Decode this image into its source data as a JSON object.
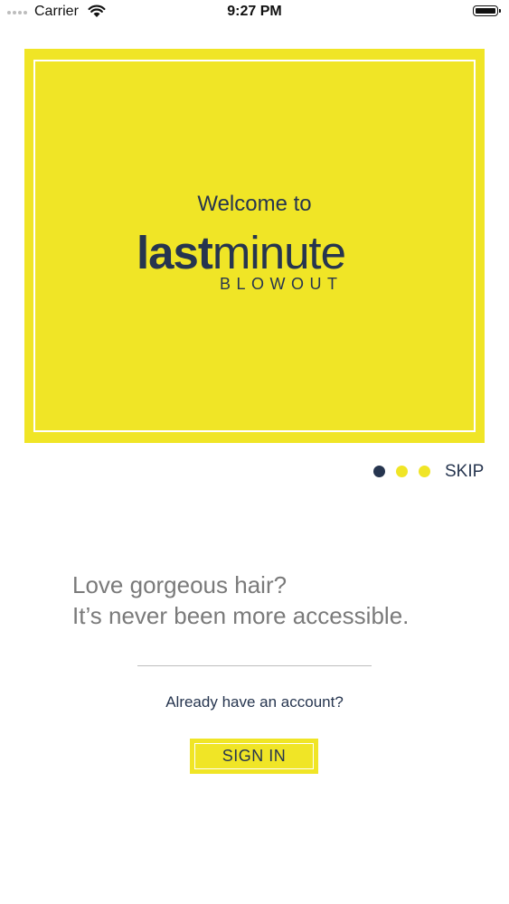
{
  "status_bar": {
    "carrier": "Carrier",
    "time": "9:27 PM",
    "icons": [
      "signal-dots-icon",
      "wifi-icon",
      "battery-icon"
    ]
  },
  "hero": {
    "welcome_text": "Welcome to",
    "logo_bold": "last",
    "logo_light": "minute",
    "logo_sub": "BLOWOUT"
  },
  "pager": {
    "pages": 3,
    "active_index": 0,
    "skip_label": "SKIP"
  },
  "tagline": {
    "line1": "Love gorgeous hair?",
    "line2": "It’s never been more accessible."
  },
  "account": {
    "question": "Already have an account?",
    "sign_in_label": "SIGN IN"
  },
  "colors": {
    "brand_yellow": "#f0e526",
    "brand_navy": "#26354f",
    "tagline_gray": "#7a7a7a"
  }
}
